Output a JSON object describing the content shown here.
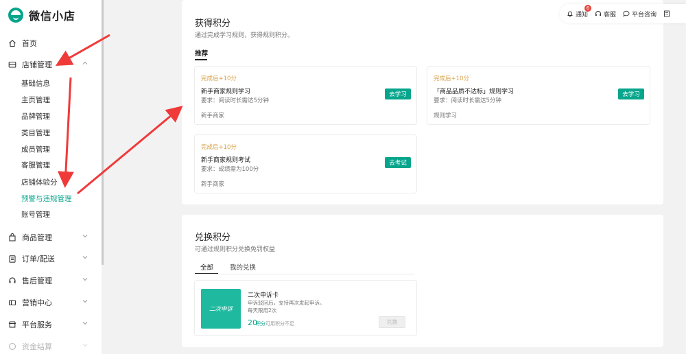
{
  "brand": {
    "name": "微信小店"
  },
  "sidebar": {
    "home": "首页",
    "store": {
      "label": "店铺管理",
      "items": [
        "基础信息",
        "主页管理",
        "品牌管理",
        "类目管理",
        "成员管理",
        "客服管理",
        "店铺体验分",
        "预警与违规管理",
        "账号管理"
      ],
      "active_index": 7
    },
    "goods": "商品管理",
    "orders": "订单/配送",
    "aftersale": "售后管理",
    "marketing": "营销中心",
    "platform": "平台服务",
    "funds": "资金结算"
  },
  "topbar": {
    "notify": "通知",
    "notify_count": "6",
    "service": "客服",
    "consult": "平台咨询"
  },
  "earn": {
    "title": "获得积分",
    "desc": "通过完成学习规则，获得规则积分。",
    "tab": "推荐",
    "tasks": [
      {
        "reward": "完成后+10分",
        "name": "新手商家规则学习",
        "req": "要求：阅读时长需达5分钟",
        "tag": "新手商家",
        "button": "去学习"
      },
      {
        "reward": "完成后+10分",
        "name": "「商品品质不达标」规则学习",
        "req": "要求：阅读时长需达5分钟",
        "tag": "规则学习",
        "button": "去学习"
      },
      {
        "reward": "完成后+10分",
        "name": "新手商家规则考试",
        "req": "要求：成绩需为100分",
        "tag": "新手商家",
        "button": "去考试"
      }
    ]
  },
  "exchange": {
    "title": "兑换积分",
    "desc": "可通过规则积分兑换免罚权益",
    "tabs": [
      "全部",
      "我的兑换"
    ],
    "item": {
      "image_text": "二次申诉",
      "name": "二次申诉卡",
      "desc1": "申诉驳回后，支持再次发起申诉。",
      "desc2": "每天限用2次",
      "points": "20",
      "points_unit": "积分",
      "note": "可用积分不足",
      "button": "兑换"
    }
  },
  "colors": {
    "accent": "#07a58c",
    "reward": "#d8a24a",
    "annotation_arrow": "#f03a3a",
    "badge": "#e8453c"
  }
}
